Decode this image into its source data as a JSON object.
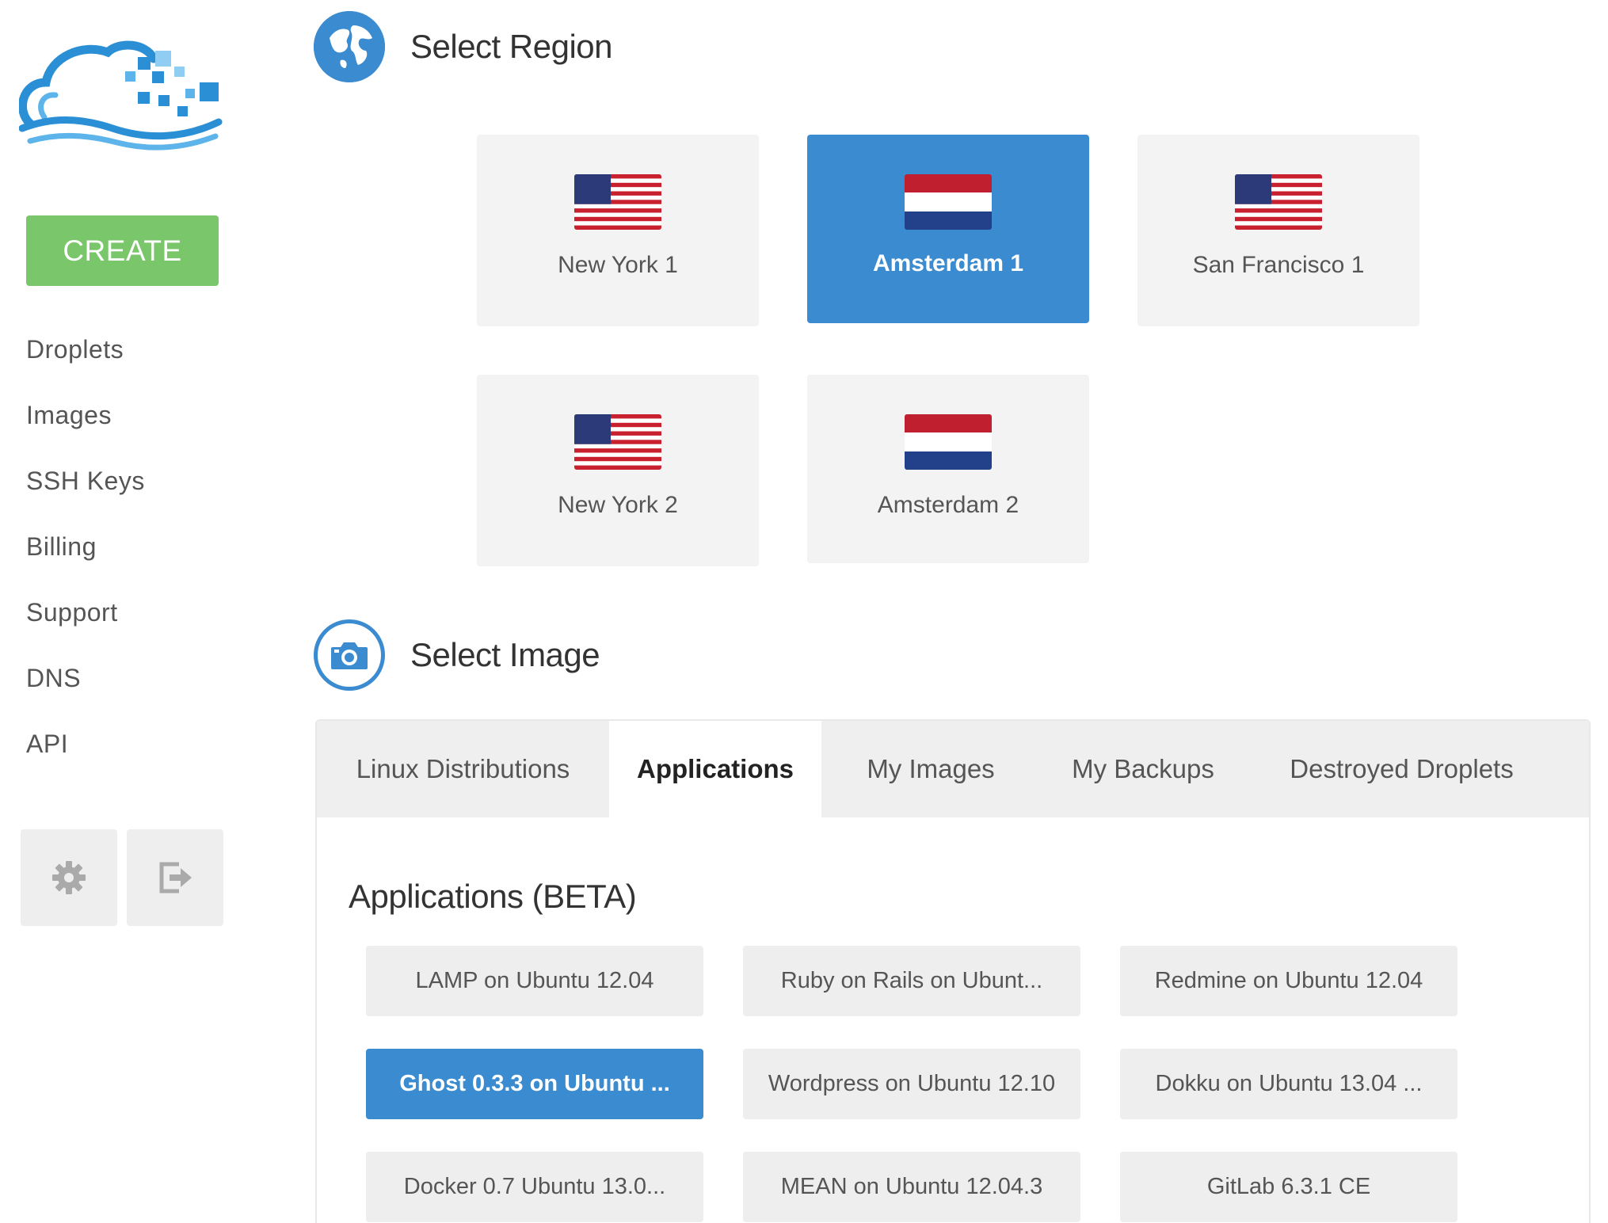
{
  "sidebar": {
    "create_label": "CREATE",
    "nav": [
      "Droplets",
      "Images",
      "SSH Keys",
      "Billing",
      "Support",
      "DNS",
      "API"
    ],
    "settings_icon": "gear-icon",
    "logout_icon": "logout-icon"
  },
  "region": {
    "title": "Select Region",
    "icon": "globe-icon",
    "options": [
      {
        "label": "New York 1",
        "flag": "us-flag",
        "selected": false
      },
      {
        "label": "Amsterdam 1",
        "flag": "nl-flag",
        "selected": true
      },
      {
        "label": "San Francisco 1",
        "flag": "us-flag",
        "selected": false
      },
      {
        "label": "New York 2",
        "flag": "us-flag",
        "selected": false
      },
      {
        "label": "Amsterdam 2",
        "flag": "nl-flag",
        "selected": false
      }
    ]
  },
  "image": {
    "title": "Select Image",
    "icon": "camera-icon",
    "tabs": [
      "Linux Distributions",
      "Applications",
      "My Images",
      "My Backups",
      "Destroyed Droplets"
    ],
    "active_tab": "Applications",
    "apps_heading": "Applications (BETA)",
    "apps": [
      "LAMP on Ubuntu 12.04",
      "Ruby on Rails on Ubunt...",
      "Redmine on Ubuntu 12.04",
      "Ghost 0.3.3 on Ubuntu ...",
      "Wordpress on Ubuntu 12.10",
      "Dokku on Ubuntu 13.04 ...",
      "Docker 0.7 Ubuntu 13.0...",
      "MEAN on Ubuntu 12.04.3",
      "GitLab 6.3.1 CE"
    ],
    "selected_app": "Ghost 0.3.3 on Ubuntu ..."
  },
  "colors": {
    "accent": "#3a8bd0",
    "create_green": "#7ac66b",
    "tile_bg": "#f3f3f3"
  }
}
